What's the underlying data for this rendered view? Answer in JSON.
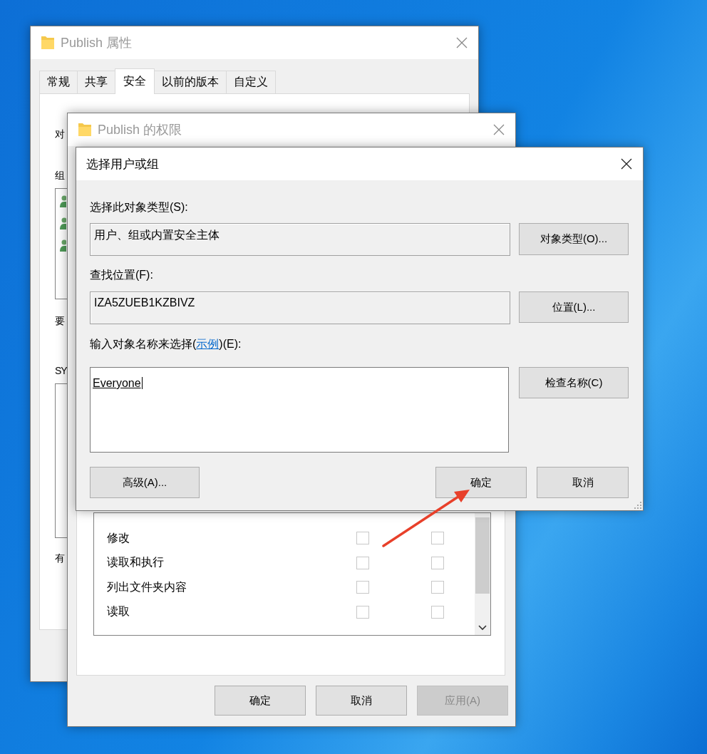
{
  "properties_window": {
    "title": "Publish 属性",
    "active": false,
    "tabs": [
      {
        "label": "常规",
        "selected": false
      },
      {
        "label": "共享",
        "selected": false
      },
      {
        "label": "安全",
        "selected": true
      },
      {
        "label": "以前的版本",
        "selected": false
      },
      {
        "label": "自定义",
        "selected": false
      }
    ],
    "fragments": [
      "对",
      "组",
      "要",
      "SY",
      "有"
    ]
  },
  "permissions_window": {
    "title": "Publish 的权限",
    "active": false,
    "permissions": [
      {
        "label": "修改",
        "allow": false,
        "deny": false
      },
      {
        "label": "读取和执行",
        "allow": false,
        "deny": false
      },
      {
        "label": "列出文件夹内容",
        "allow": false,
        "deny": false
      },
      {
        "label": "读取",
        "allow": false,
        "deny": false
      }
    ],
    "buttons": [
      {
        "label": "确定",
        "disabled": false
      },
      {
        "label": "取消",
        "disabled": false
      },
      {
        "label": "应用(A)",
        "disabled": true
      }
    ]
  },
  "select_dialog": {
    "title": "选择用户或组",
    "active": true,
    "object_type_label": "选择此对象类型(S):",
    "object_type_value": "用户、组或内置安全主体",
    "object_type_button": "对象类型(O)...",
    "location_label": "查找位置(F):",
    "location_value": "IZA5ZUEB1KZBIVZ",
    "location_button": "位置(L)...",
    "name_label": {
      "before": "输入对象名称来选择(",
      "link": "示例",
      "after": ")(E):"
    },
    "name_value": "Everyone",
    "check_button": "检查名称(C)",
    "advanced_button": "高级(A)...",
    "ok_button": "确定",
    "cancel_button": "取消"
  }
}
